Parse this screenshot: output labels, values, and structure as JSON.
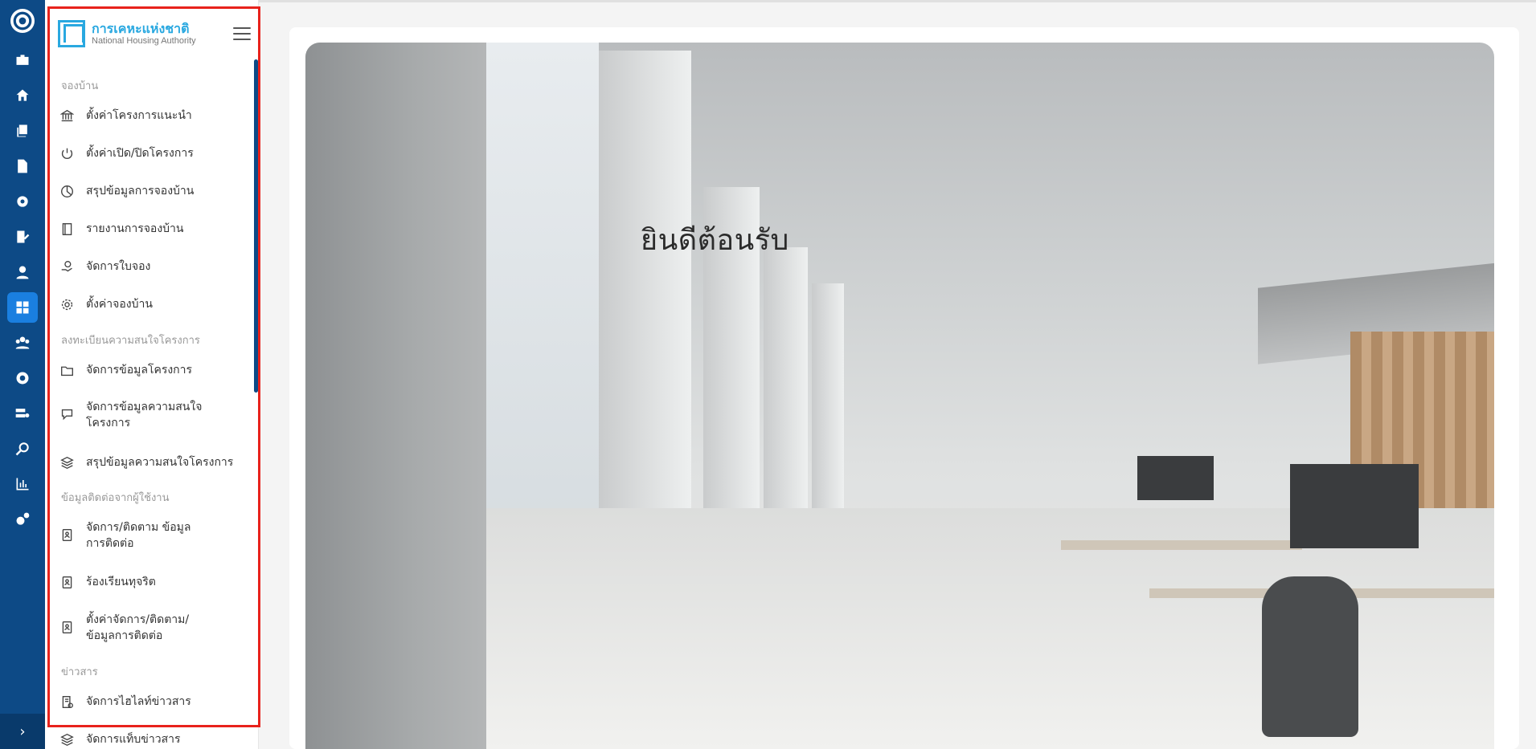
{
  "brand": {
    "name_th": "การเคหะแห่งชาติ",
    "name_en": "National Housing Authority"
  },
  "rail": {
    "icons": [
      "logo-icon",
      "briefcase-icon",
      "home-icon",
      "copy-icon",
      "file-icon",
      "gear-badge-icon",
      "edit-list-icon",
      "user-icon",
      "dashboard-icon",
      "team-icon",
      "settings-circle-icon",
      "server-settings-icon",
      "search-icon",
      "bar-chart-icon",
      "cogs-icon"
    ],
    "expand_label": "›"
  },
  "menu": {
    "sections": [
      {
        "title": "จองบ้าน",
        "items": [
          {
            "label": "ตั้งค่าโครงการแนะนำ",
            "icon": "bank-icon"
          },
          {
            "label": "ตั้งค่าเปิด/ปิดโครงการ",
            "icon": "power-icon"
          },
          {
            "label": "สรุปข้อมูลการจองบ้าน",
            "icon": "pie-chart-icon"
          },
          {
            "label": "รายงานการจองบ้าน",
            "icon": "book-icon"
          },
          {
            "label": "จัดการใบจอง",
            "icon": "hand-money-icon"
          },
          {
            "label": "ตั้งค่าจองบ้าน",
            "icon": "gear-icon"
          }
        ]
      },
      {
        "title": "ลงทะเบียนความสนใจโครงการ",
        "items": [
          {
            "label": "จัดการข้อมูลโครงการ",
            "icon": "folder-icon"
          },
          {
            "label": "จัดการข้อมูลความสนใจโครงการ",
            "icon": "comment-icon"
          },
          {
            "label": "สรุปข้อมูลความสนใจโครงการ",
            "icon": "layers-icon"
          }
        ]
      },
      {
        "title": "ข้อมูลติดต่อจากผู้ใช้งาน",
        "items": [
          {
            "label": "จัดการ/ติดตาม ข้อมูลการติดต่อ",
            "icon": "contact-card-icon"
          },
          {
            "label": "ร้องเรียนทุจริต",
            "icon": "contact-card-icon"
          },
          {
            "label": "ตั้งค่าจัดการ/ติดตาม/ข้อมูลการติดต่อ",
            "icon": "contact-card-icon"
          }
        ]
      },
      {
        "title": "ข่าวสาร",
        "items": [
          {
            "label": "จัดการไฮไลท์ข่าวสาร",
            "icon": "news-settings-icon"
          },
          {
            "label": "จัดการแท็บข่าวสาร",
            "icon": "layers-icon"
          }
        ]
      }
    ]
  },
  "main": {
    "welcome_text": "ยินดีต้อนรับ"
  },
  "colors": {
    "rail_bg": "#0d4a86",
    "active_item": "#1a7fe0",
    "brand_blue": "#29a8e0",
    "highlight_border": "#e8221c"
  }
}
